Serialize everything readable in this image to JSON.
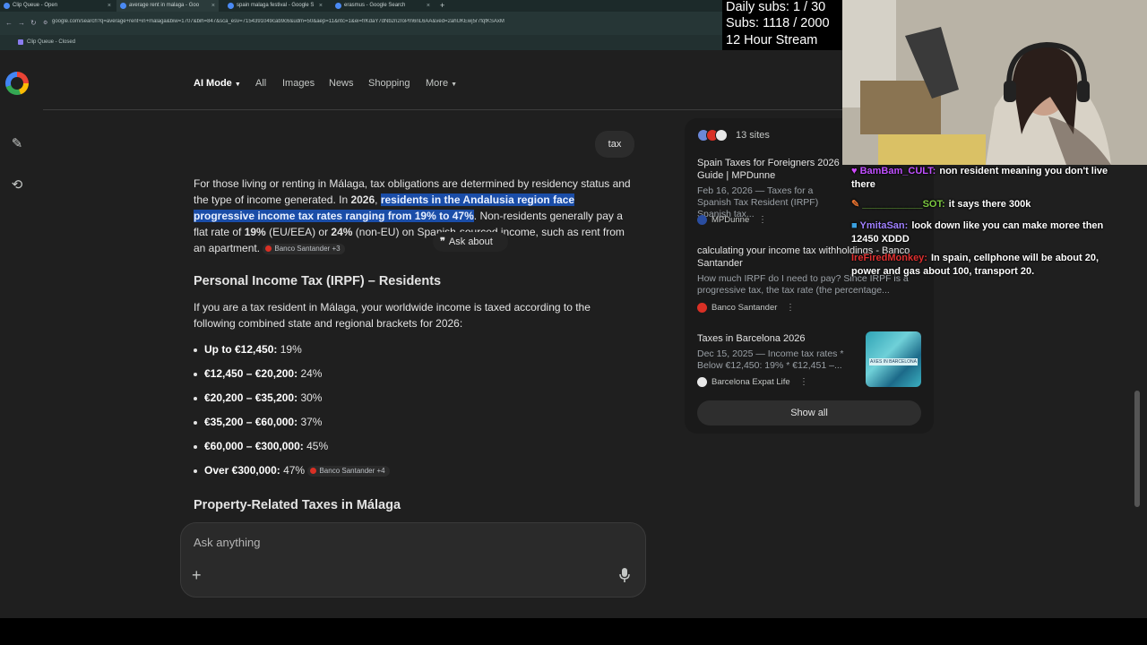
{
  "browser": {
    "tabs": [
      {
        "label": "Clip Queue - Open"
      },
      {
        "label": "average rent in malaga - Goo"
      },
      {
        "label": "spain malaga festival - Google S"
      },
      {
        "label": "erasmus - Google Search"
      }
    ],
    "new_tab": "+",
    "url": "google.com/search?q=average+rent+in+malaga&biw=1707&bih=847&sca_esv=7154391049cab9c6&udm=50&aep=11&ntc=1&ei=frKdaY7dNb2n2roPm6nL6AA&ved=2ahUKEwj5r7fqfKSAxM",
    "bookmark": "Clip Queue - Closed"
  },
  "stream": {
    "daily_subs": "Daily subs: 1 / 30",
    "subs": "Subs: 1118 / 2000",
    "stream_label": "12 Hour Stream",
    "chat": [
      {
        "user": "BamBam_CULT:",
        "message": "non resident meaning you don't live there",
        "color": "#c050ff"
      },
      {
        "user": "___________SOT:",
        "message": "it says there 300k",
        "color": "#7cc840"
      },
      {
        "user": "YmitaSan:",
        "message": "look down like you can make moree then 12450 XDDD",
        "color": "#a080ff"
      },
      {
        "user": "IreFiredMonkey:",
        "message": "In spain, cellphone will be about 20, power and gas about 100, transport 20.",
        "color": "#e03030"
      }
    ]
  },
  "nav": {
    "tabs": [
      "AI Mode",
      "All",
      "Images",
      "News",
      "Shopping",
      "More"
    ]
  },
  "query": "tax",
  "answer": {
    "intro_1": "For those living or renting in Málaga, tax obligations are determined by residency status and the type of income generated. In ",
    "intro_year": "2026",
    "intro_comma": ", ",
    "intro_highlight": "residents in the Andalusia region face progressive income tax rates ranging from 19% to 47%",
    "intro_2": ". Non-residents generally pay a flat rate of ",
    "intro_rate_eu": "19%",
    "intro_eu": " (EU/EEA) or ",
    "intro_rate_non_eu": "24%",
    "intro_3": " (non-EU) on Spanish-sourced income, such as rent from an apartment.",
    "intro_cite": "Banco Santander +3",
    "ask_about": "Ask about",
    "section_1_title": "Personal Income Tax (IRPF) – Residents",
    "section_1_text": "If you are a tax resident in Málaga, your worldwide income is taxed according to the following combined state and regional brackets for 2026:",
    "brackets": [
      {
        "range": "Up to €12,450:",
        "rate": "19%"
      },
      {
        "range": "€12,450 – €20,200:",
        "rate": "24%"
      },
      {
        "range": "€20,200 – €35,200:",
        "rate": "30%"
      },
      {
        "range": "€35,200 – €60,000:",
        "rate": "37%"
      },
      {
        "range": "€60,000 – €300,000:",
        "rate": "45%"
      },
      {
        "range": "Over €300,000:",
        "rate": "47%"
      }
    ],
    "brackets_cite": "Banco Santander +4",
    "section_2_title": "Property-Related Taxes in Málaga"
  },
  "ask_box": {
    "placeholder": "Ask anything",
    "plus": "+"
  },
  "sources": {
    "count": "13 sites",
    "items": [
      {
        "title": "Spain Taxes for Foreigners 2026 Guide | MPDunne",
        "snippet": "Feb 16, 2026 — Taxes for a Spanish Tax Resident (IRPF) Spanish tax...",
        "site": "MPDunne"
      },
      {
        "title": "calculating your income tax withholdings - Banco Santander",
        "snippet": "How much IRPF do I need to pay? Since IRPF is a progressive tax, the tax rate (the percentage...",
        "site": "Banco Santander"
      },
      {
        "title": "Taxes in Barcelona 2026",
        "snippet": "Dec 15, 2025 — Income tax rates * Below €12,450: 19% * €12,451 –...",
        "site": "Barcelona Expat Life",
        "thumb_text": "AXES IN BARCELONA"
      }
    ],
    "show_all": "Show all"
  },
  "colors": {
    "highlight": "#1a4da8",
    "background": "#1f1f1f"
  }
}
